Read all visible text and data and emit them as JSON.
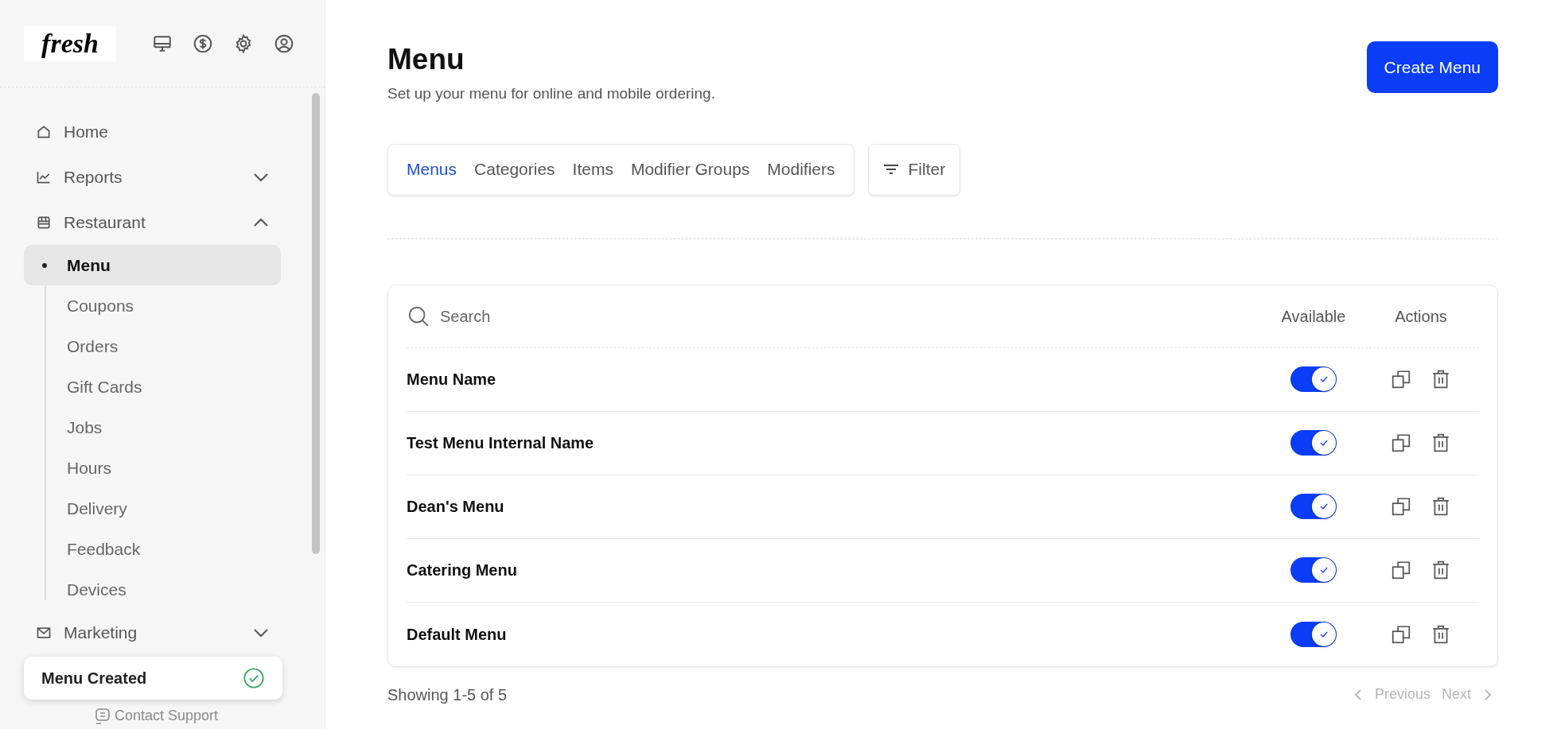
{
  "logo": {
    "text": "fresh"
  },
  "sidebar": {
    "items": [
      {
        "label": "Home"
      },
      {
        "label": "Reports",
        "expanded": false
      },
      {
        "label": "Restaurant",
        "expanded": true,
        "children": [
          {
            "label": "Menu",
            "selected": true
          },
          {
            "label": "Coupons",
            "selected": false
          },
          {
            "label": "Orders",
            "selected": false
          },
          {
            "label": "Gift Cards",
            "selected": false
          },
          {
            "label": "Jobs",
            "selected": false
          },
          {
            "label": "Hours",
            "selected": false
          },
          {
            "label": "Delivery",
            "selected": false
          },
          {
            "label": "Feedback",
            "selected": false
          },
          {
            "label": "Devices",
            "selected": false
          }
        ]
      },
      {
        "label": "Marketing",
        "expanded": false
      }
    ],
    "footer_link": "Contact Support"
  },
  "toast": {
    "text": "Menu Created"
  },
  "header": {
    "title": "Menu",
    "subtitle": "Set up your menu for online and mobile ordering.",
    "primary_button": "Create Menu"
  },
  "tabs": [
    {
      "label": "Menus",
      "selected": true
    },
    {
      "label": "Categories",
      "selected": false
    },
    {
      "label": "Items",
      "selected": false
    },
    {
      "label": "Modifier Groups",
      "selected": false
    },
    {
      "label": "Modifiers",
      "selected": false
    }
  ],
  "filter_button": "Filter",
  "table": {
    "search": {
      "placeholder": "Search"
    },
    "columns": [
      "Available",
      "Actions"
    ],
    "rows": [
      {
        "name": "Menu Name",
        "available": true
      },
      {
        "name": "Test Menu Internal Name",
        "available": true
      },
      {
        "name": "Dean's Menu",
        "available": true
      },
      {
        "name": "Catering Menu",
        "available": true
      },
      {
        "name": "Default Menu",
        "available": true
      }
    ]
  },
  "pagination": {
    "summary": "Showing 1-5 of 5",
    "previous": "Previous",
    "next": "Next"
  }
}
